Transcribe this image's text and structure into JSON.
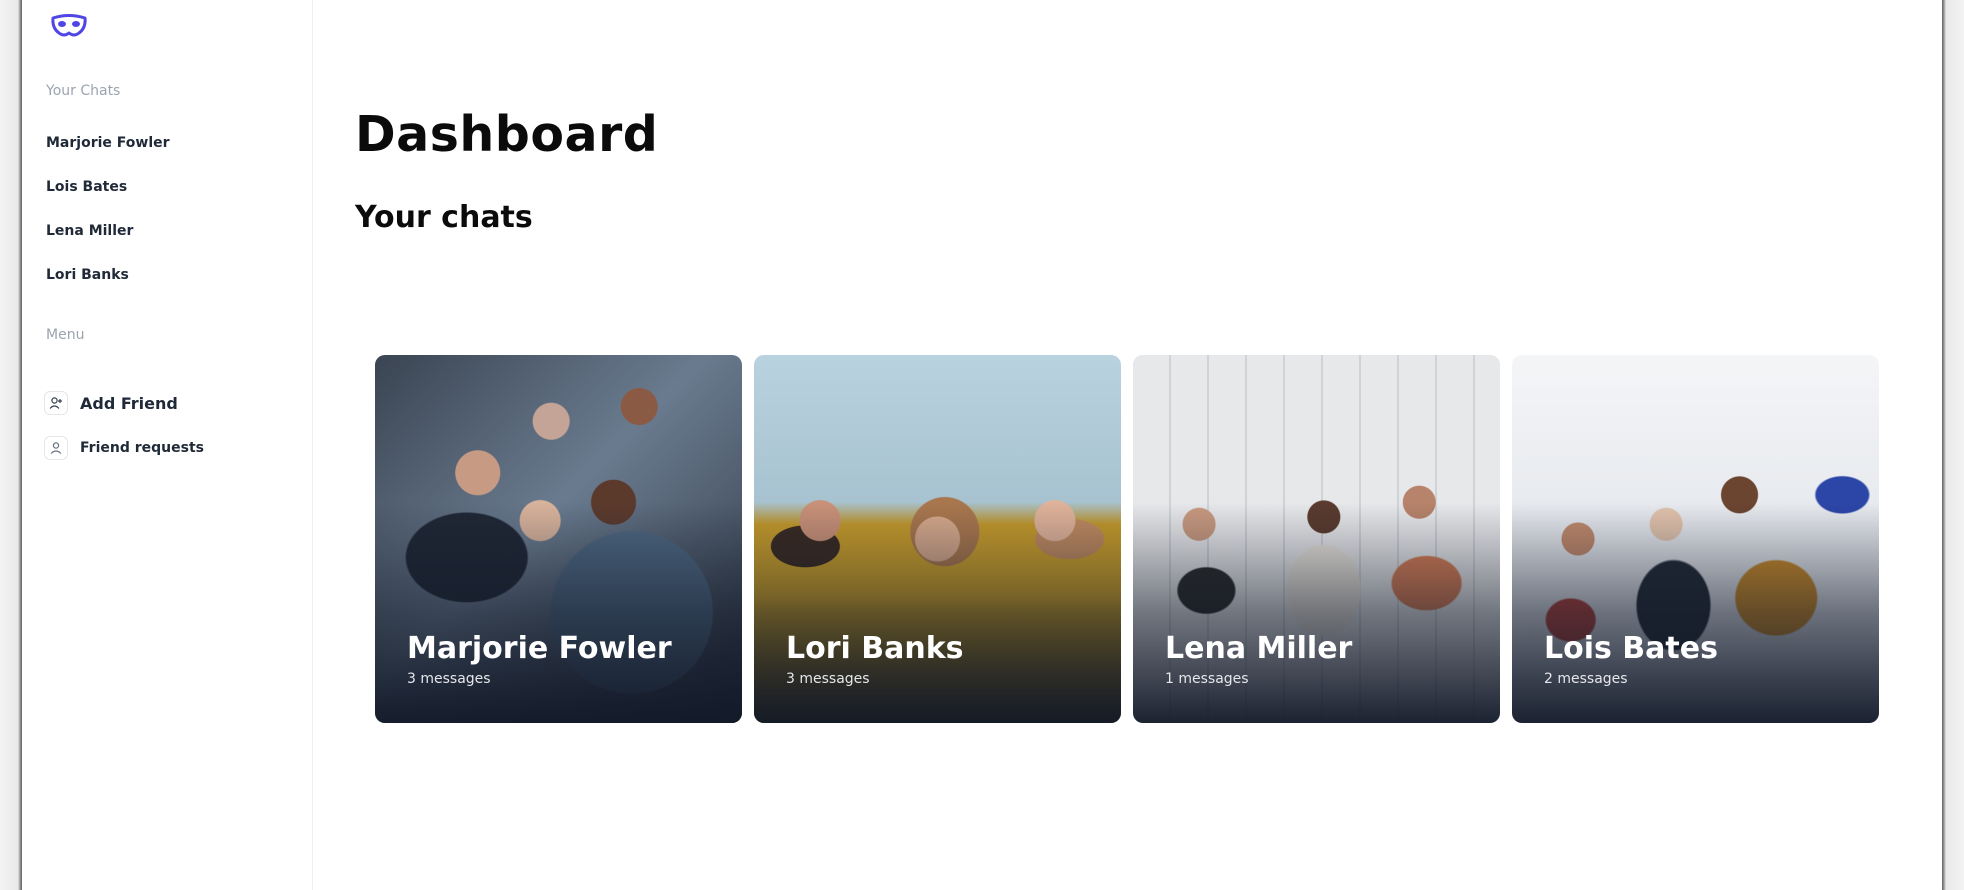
{
  "sidebar": {
    "your_chats_label": "Your Chats",
    "chats": [
      {
        "name": "Marjorie Fowler"
      },
      {
        "name": "Lois Bates"
      },
      {
        "name": "Lena Miller"
      },
      {
        "name": "Lori Banks"
      }
    ],
    "menu_label": "Menu",
    "menu": [
      {
        "label": "Add Friend",
        "icon": "add-user-icon"
      },
      {
        "label": "Friend requests",
        "icon": "user-icon"
      }
    ]
  },
  "main": {
    "title": "Dashboard",
    "subtitle": "Your chats",
    "cards": [
      {
        "name": "Marjorie Fowler",
        "count": "3 messages"
      },
      {
        "name": "Lori Banks",
        "count": "3 messages"
      },
      {
        "name": "Lena Miller",
        "count": "1 messages"
      },
      {
        "name": "Lois Bates",
        "count": "2 messages"
      }
    ]
  },
  "colors": {
    "accent": "#4f46e5",
    "card_overlay": "#111827",
    "muted_text": "#9ca3af"
  }
}
